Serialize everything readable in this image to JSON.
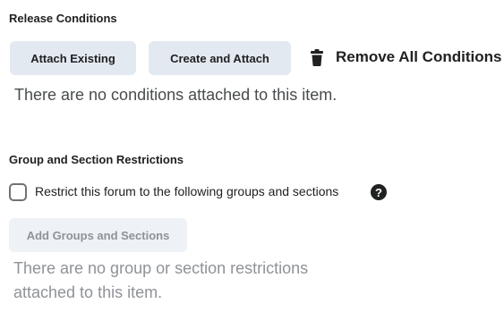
{
  "release_conditions": {
    "heading": "Release Conditions",
    "attach_existing_label": "Attach Existing",
    "create_and_attach_label": "Create and Attach",
    "remove_all_label": "Remove All Conditions",
    "remove_all_icon": "trash-icon",
    "empty_message": "There are no conditions attached to this item."
  },
  "group_restrictions": {
    "heading": "Group and Section Restrictions",
    "restrict_checkbox_label": "Restrict this forum to the following groups and sections",
    "restrict_checked": false,
    "help_icon": "question-circle-icon",
    "help_glyph": "?",
    "add_button_label": "Add Groups and Sections",
    "add_button_disabled": true,
    "empty_message": "There are no group or section restrictions attached to this item."
  },
  "colors": {
    "button_bg": "#e3e9f1",
    "button_disabled_bg": "#eef1f5",
    "text": "#202122",
    "muted_text": "#8f9297"
  }
}
